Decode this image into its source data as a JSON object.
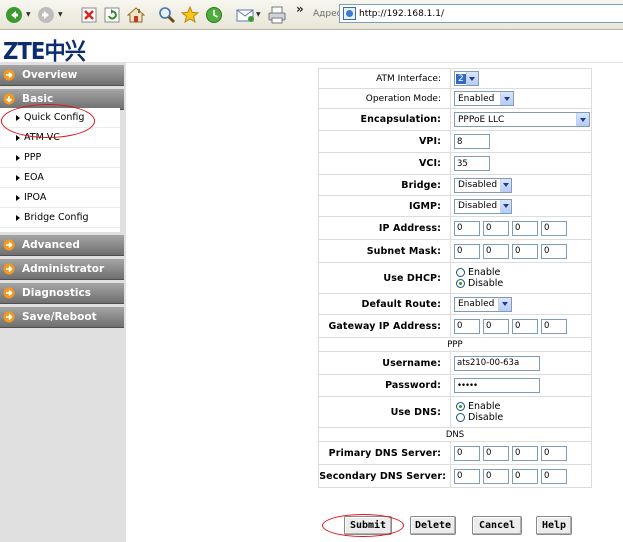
{
  "browser": {
    "address_label": "Адрес:",
    "url": "http://192.168.1.1/",
    "toolbar_icons": [
      "back-icon",
      "forward-icon",
      "stop-icon",
      "refresh-icon",
      "home-icon",
      "search-icon",
      "favorites-icon",
      "history-icon",
      "mail-icon",
      "print-icon"
    ]
  },
  "logo": {
    "text": "ZTE中兴",
    "color": "#0b2c6e"
  },
  "sidebar": {
    "menus": [
      {
        "label": "Overview"
      },
      {
        "label": "Basic"
      },
      {
        "label": "Advanced"
      },
      {
        "label": "Administrator"
      },
      {
        "label": "Diagnostics"
      },
      {
        "label": "Save/Reboot"
      }
    ],
    "basic_items": [
      {
        "label": "Quick Config"
      },
      {
        "label": "ATM VC"
      },
      {
        "label": "PPP"
      },
      {
        "label": "EOA"
      },
      {
        "label": "IPOA"
      },
      {
        "label": "Bridge Config"
      }
    ]
  },
  "form": {
    "atm_interface": {
      "label": "ATM Interface:",
      "value": "2"
    },
    "operation_mode": {
      "label": "Operation Mode:",
      "value": "Enabled"
    },
    "encapsulation": {
      "label": "Encapsulation:",
      "value": "PPPoE LLC"
    },
    "vpi": {
      "label": "VPI:",
      "value": "8"
    },
    "vci": {
      "label": "VCI:",
      "value": "35"
    },
    "bridge": {
      "label": "Bridge:",
      "value": "Disabled"
    },
    "igmp": {
      "label": "IGMP:",
      "value": "Disabled"
    },
    "ip_address": {
      "label": "IP Address:",
      "octets": [
        "0",
        "0",
        "0",
        "0"
      ]
    },
    "subnet_mask": {
      "label": "Subnet Mask:",
      "octets": [
        "0",
        "0",
        "0",
        "0"
      ]
    },
    "use_dhcp": {
      "label": "Use DHCP:",
      "enable": "Enable",
      "disable": "Disable",
      "selected": "Disable"
    },
    "default_route": {
      "label": "Default Route:",
      "value": "Enabled"
    },
    "gateway_ip": {
      "label": "Gateway IP Address:",
      "octets": [
        "0",
        "0",
        "0",
        "0"
      ]
    },
    "ppp_section": "PPP",
    "username": {
      "label": "Username:",
      "value": "ats210-00-63a"
    },
    "password": {
      "label": "Password:",
      "value": "•••••"
    },
    "use_dns": {
      "label": "Use DNS:",
      "enable": "Enable",
      "disable": "Disable",
      "selected": "Enable"
    },
    "dns_section": "DNS",
    "primary_dns": {
      "label": "Primary DNS Server:",
      "octets": [
        "0",
        "0",
        "0",
        "0"
      ]
    },
    "secondary_dns": {
      "label": "Secondary DNS Server:",
      "octets": [
        "0",
        "0",
        "0",
        "0"
      ]
    }
  },
  "actions": {
    "submit": "Submit",
    "delete": "Delete",
    "cancel": "Cancel",
    "help": "Help"
  },
  "colors": {
    "menu_gradient_top": "#a5a5a5",
    "menu_gradient_bottom": "#6f6f6f",
    "menu_arrow": "#f39a1e",
    "annotation_circle": "#e0141e"
  }
}
